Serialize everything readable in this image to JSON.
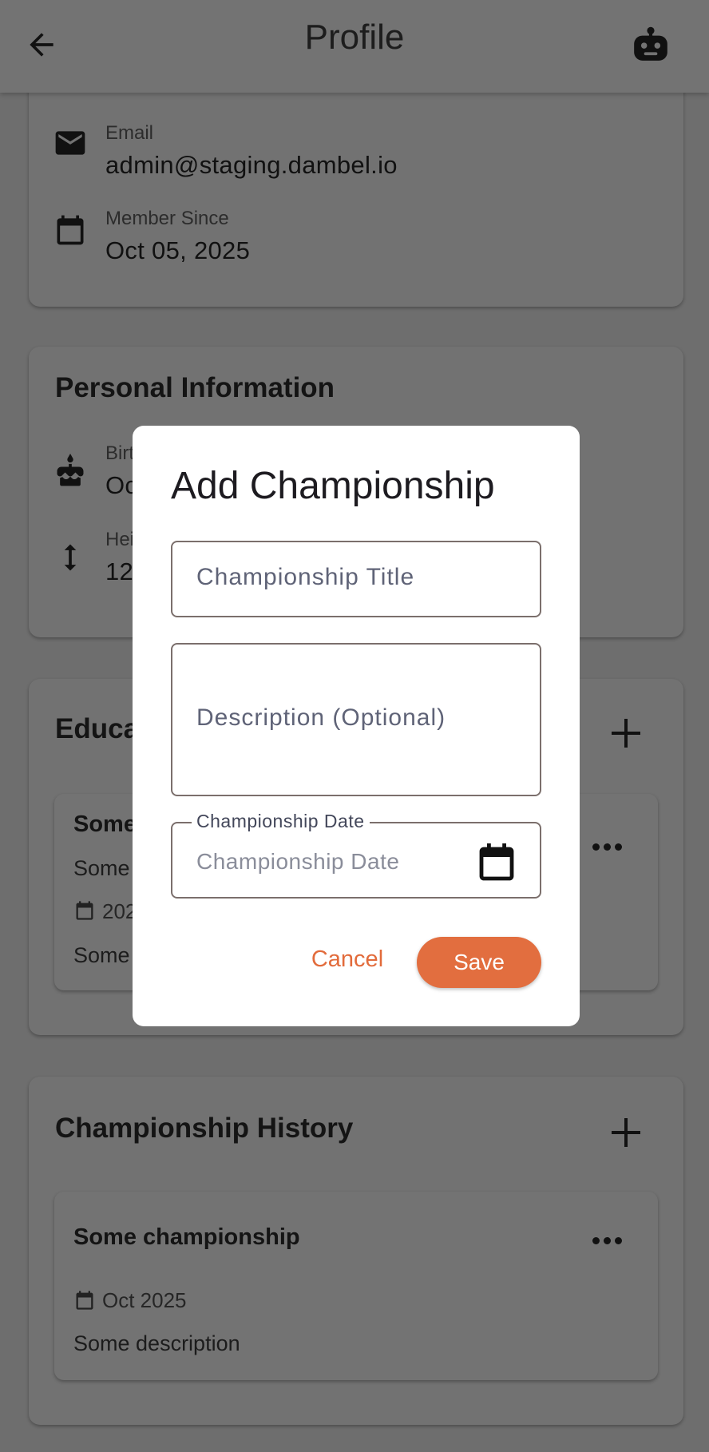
{
  "appbar": {
    "title": "Profile",
    "back_icon": "arrow-back-icon",
    "assistant_icon": "robot-icon"
  },
  "account": {
    "email_label": "Email",
    "email_value": "admin@staging.dambel.io",
    "member_label": "Member Since",
    "member_value": "Oct 05, 2025"
  },
  "personal": {
    "title": "Personal Information",
    "birth_label": "Birt",
    "birth_value": "Oc",
    "height_label": "Hei",
    "height_value": "12"
  },
  "education": {
    "title": "Educa",
    "entry": {
      "title": "Some",
      "subtitle": "Some",
      "date": "202",
      "description": "Some"
    }
  },
  "championships": {
    "title": "Championship History",
    "entry": {
      "title": "Some championship",
      "date": "Oct 2025",
      "description": "Some description"
    }
  },
  "dialog": {
    "title": "Add Championship",
    "title_placeholder": "Championship Title",
    "description_placeholder": "Description (Optional)",
    "date_label": "Championship Date",
    "date_placeholder": "Championship Date",
    "cancel_label": "Cancel",
    "save_label": "Save"
  },
  "colors": {
    "accent": "#e26e3f",
    "scrim_background": "#6e6e6e",
    "dialog_background": "#ffffff"
  }
}
